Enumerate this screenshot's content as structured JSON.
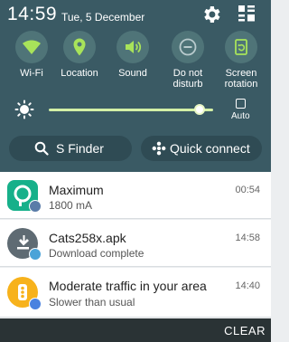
{
  "status": {
    "time": "14:59",
    "date": "Tue, 5 December"
  },
  "toggles": [
    {
      "label": "Wi-Fi",
      "icon": "wifi-icon",
      "active": true
    },
    {
      "label": "Location",
      "icon": "location-icon",
      "active": true
    },
    {
      "label": "Sound",
      "icon": "sound-icon",
      "active": true
    },
    {
      "label": "Do not disturb",
      "icon": "do-not-disturb-icon",
      "active": false
    },
    {
      "label": "Screen rotation",
      "icon": "screen-rotation-icon",
      "active": true
    }
  ],
  "brightness": {
    "level": 0.92,
    "auto_label": "Auto"
  },
  "actions": {
    "finder_label": "S Finder",
    "quick_connect_label": "Quick connect"
  },
  "notifications": [
    {
      "title": "Maximum",
      "subtitle": "1800 mA",
      "time": "00:54",
      "icon": "battery-app-icon"
    },
    {
      "title": "Cats258x.apk",
      "subtitle": "Download complete",
      "time": "14:58",
      "icon": "download-icon"
    },
    {
      "title": "Moderate traffic in your area",
      "subtitle": "Slower than usual",
      "time": "14:40",
      "icon": "traffic-icon"
    }
  ],
  "footer": {
    "clear_label": "CLEAR"
  },
  "colors": {
    "accent": "#a8e35a",
    "shade": "#3a5a64",
    "toggle_bg": "#4f7478"
  }
}
